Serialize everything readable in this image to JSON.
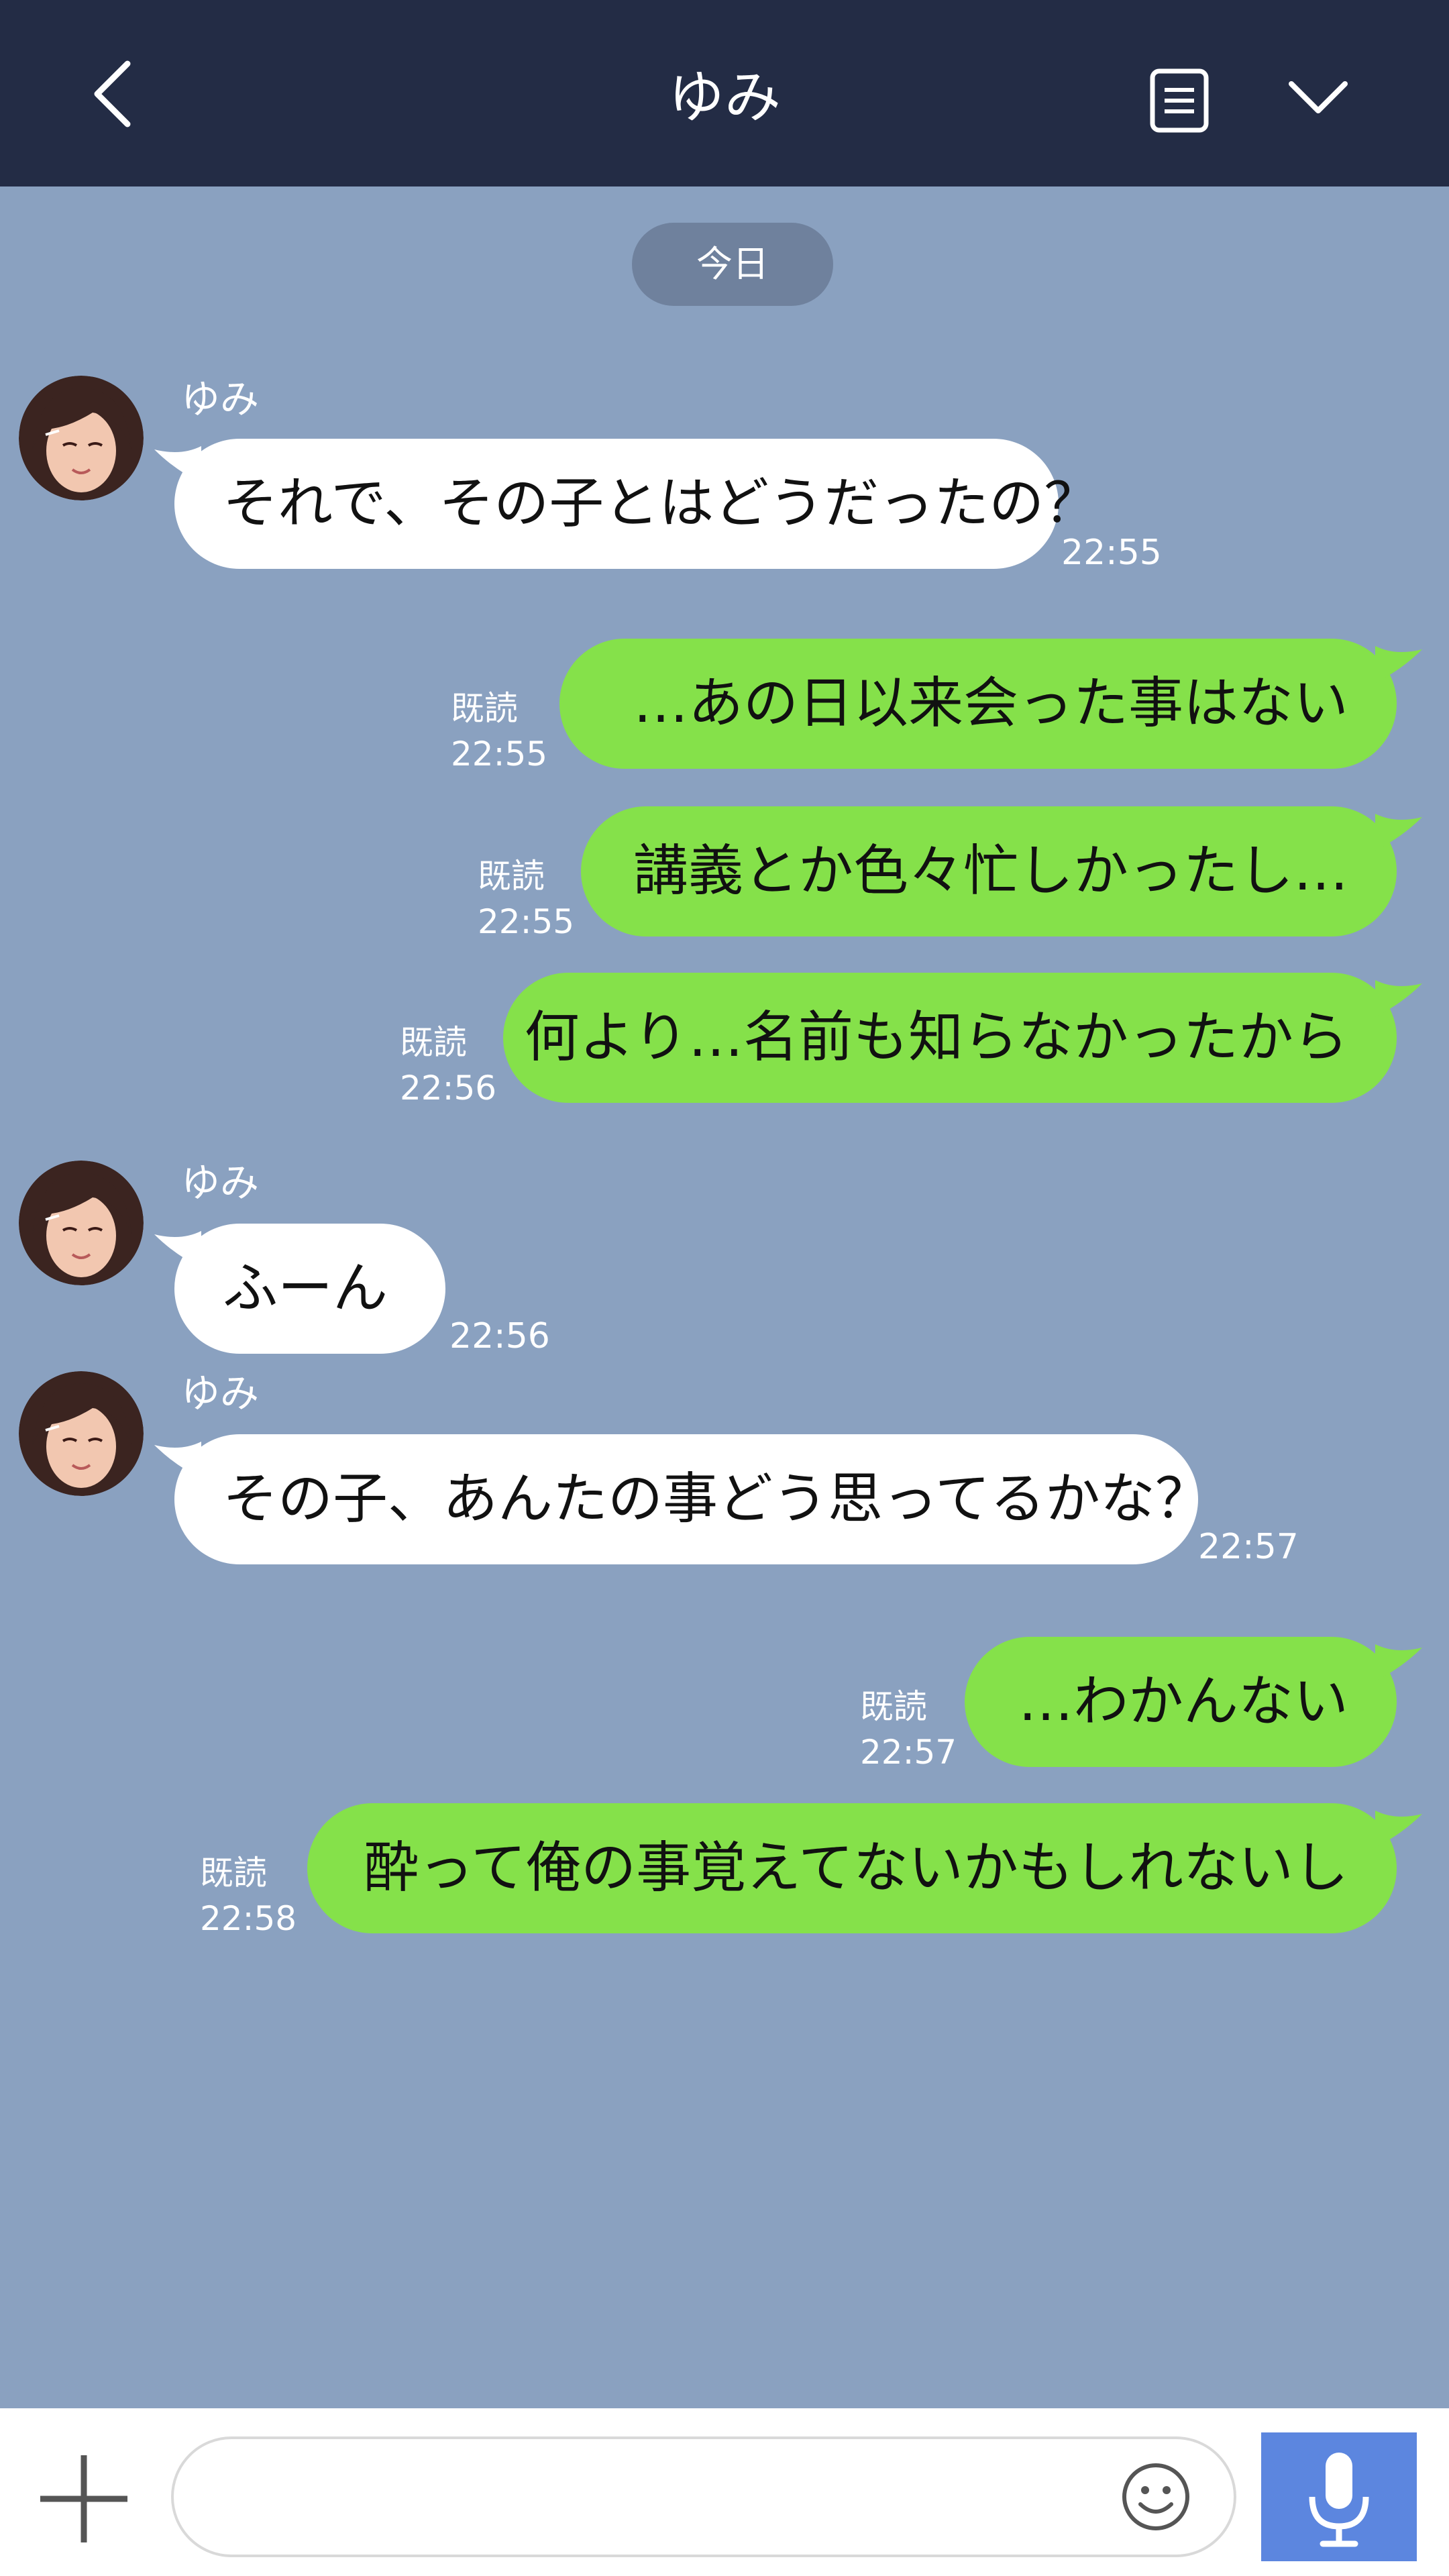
{
  "header": {
    "title": "ゆみ",
    "back_icon": "chevron-left-icon",
    "notes_icon": "notes-icon",
    "dropdown_icon": "chevron-down-icon",
    "background": "#232c45"
  },
  "date_badge": "今日",
  "messages": [
    {
      "direction": "incoming",
      "sender": "ゆみ",
      "text": "それで、その子とはどうだったの？",
      "time": "22:55"
    },
    {
      "direction": "outgoing",
      "read": "既読",
      "text": "…あの日以来会った事はない",
      "time": "22:55"
    },
    {
      "direction": "outgoing",
      "read": "既読",
      "text": "講義とか色々忙しかったし…",
      "time": "22:55"
    },
    {
      "direction": "outgoing",
      "read": "既読",
      "text": "何より…名前も知らなかったから",
      "time": "22:56"
    },
    {
      "direction": "incoming",
      "sender": "ゆみ",
      "text": "ふーん",
      "time": "22:56"
    },
    {
      "direction": "incoming",
      "sender": "ゆみ",
      "text": "その子、あんたの事どう思ってるかな？",
      "time": "22:57"
    },
    {
      "direction": "outgoing",
      "read": "既読",
      "text": "…わかんない",
      "time": "22:57"
    },
    {
      "direction": "outgoing",
      "read": "既読",
      "text": "酔って俺の事覚えてないかもしれないし",
      "time": "22:58"
    }
  ],
  "input_bar": {
    "plus_icon": "plus-icon",
    "placeholder": "",
    "value": "",
    "emoji_icon": "smiley-icon",
    "mic_icon": "microphone-icon"
  },
  "colors": {
    "chat_background": "#8aa1c0",
    "outgoing_bubble": "#85e14a",
    "incoming_bubble": "#ffffff",
    "date_badge": "#6f819d",
    "mic_button": "#5c86df"
  }
}
